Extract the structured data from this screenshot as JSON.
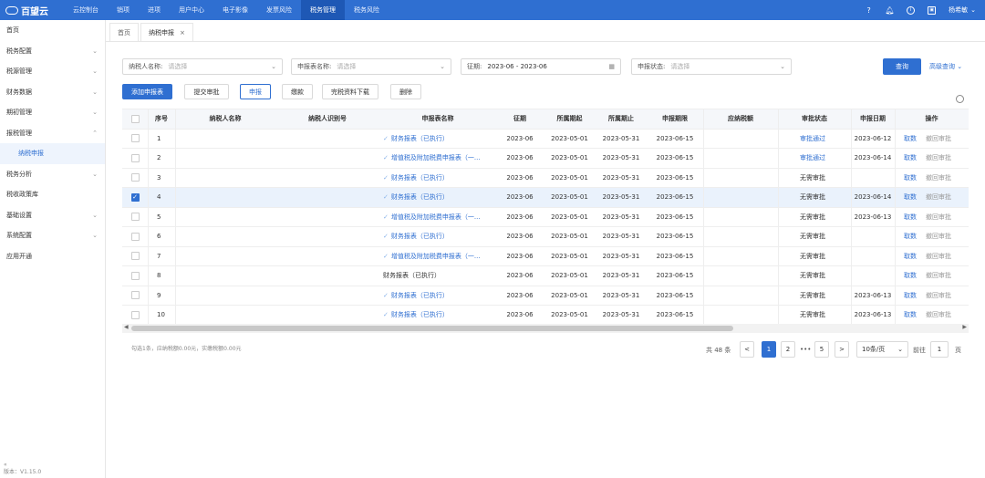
{
  "app": {
    "brand": "百望云"
  },
  "nav": {
    "items": [
      "云控制台",
      "销项",
      "进项",
      "用户中心",
      "电子影像",
      "发票风险",
      "税务管理",
      "税务风险"
    ],
    "active_index": 6
  },
  "topright": {
    "username": "杨希敏"
  },
  "sidebar": {
    "items": [
      {
        "label": "首页",
        "chevron": ""
      },
      {
        "label": "税务配置",
        "chevron": "⌄"
      },
      {
        "label": "税源管理",
        "chevron": "⌄"
      },
      {
        "label": "财务数据",
        "chevron": "⌄"
      },
      {
        "label": "期初管理",
        "chevron": "⌄"
      },
      {
        "label": "报税管理",
        "chevron": "⌃"
      },
      {
        "label": "纳税申报",
        "chevron": "",
        "sub": true
      },
      {
        "label": "税务分析",
        "chevron": "⌄"
      },
      {
        "label": "税收政策库",
        "chevron": ""
      },
      {
        "label": "基础设置",
        "chevron": "⌄"
      },
      {
        "label": "系统配置",
        "chevron": "⌄"
      },
      {
        "label": "应用开通",
        "chevron": ""
      }
    ],
    "collapse": "«",
    "version": "版本：V1.15.0"
  },
  "tabs": [
    {
      "label": "首页",
      "closable": false
    },
    {
      "label": "纳税申报",
      "closable": true
    }
  ],
  "filters": {
    "taxpayer": {
      "label": "纳税人名称:",
      "placeholder": "请选择"
    },
    "form": {
      "label": "申报表名称:",
      "placeholder": "请选择"
    },
    "period": {
      "label": "征期:",
      "value": "2023-06 - 2023-06"
    },
    "status": {
      "label": "申报状态:",
      "placeholder": "请选择"
    },
    "query_label": "查询",
    "advanced_label": "高级查询 ⌄"
  },
  "actions": [
    "添加申报表",
    "提交审批",
    "申报",
    "缴款",
    "完税资料下载",
    "删除"
  ],
  "table": {
    "headers": {
      "index": "序号",
      "taxpayer_name": "纳税人名称",
      "taxpayer_id": "纳税人识别号",
      "form": "申报表名称",
      "period": "征期",
      "start": "所属期起",
      "end": "所属期止",
      "deadline": "申报期限",
      "tax_due": "应纳税额",
      "approval": "审批状态",
      "date": "申报日期",
      "ops": "操作"
    },
    "rows": [
      {
        "index": "1",
        "form": "财务报表（已执行）",
        "form_link": true,
        "period": "2023-06",
        "start": "2023-05-01",
        "end": "2023-05-31",
        "deadline": "2023-06-15",
        "approval": "审批通过",
        "approval_link": true,
        "date": "2023-06-12",
        "op1": "取数",
        "op2": "撤回审批",
        "checked": false
      },
      {
        "index": "2",
        "form": "增值税及附加税费申报表（一...",
        "form_link": true,
        "period": "2023-06",
        "start": "2023-05-01",
        "end": "2023-05-31",
        "deadline": "2023-06-15",
        "approval": "审批通过",
        "approval_link": true,
        "date": "2023-06-14",
        "op1": "取数",
        "op2": "撤回审批",
        "checked": false
      },
      {
        "index": "3",
        "form": "财务报表（已执行）",
        "form_link": true,
        "period": "2023-06",
        "start": "2023-05-01",
        "end": "2023-05-31",
        "deadline": "2023-06-15",
        "approval": "无需审批",
        "approval_link": false,
        "date": "",
        "op1": "取数",
        "op2": "撤回审批",
        "checked": false
      },
      {
        "index": "4",
        "form": "财务报表（已执行）",
        "form_link": true,
        "period": "2023-06",
        "start": "2023-05-01",
        "end": "2023-05-31",
        "deadline": "2023-06-15",
        "approval": "无需审批",
        "approval_link": false,
        "date": "2023-06-14",
        "op1": "取数",
        "op2": "撤回审批",
        "checked": true
      },
      {
        "index": "5",
        "form": "增值税及附加税费申报表（一...",
        "form_link": true,
        "period": "2023-06",
        "start": "2023-05-01",
        "end": "2023-05-31",
        "deadline": "2023-06-15",
        "approval": "无需审批",
        "approval_link": false,
        "date": "2023-06-13",
        "op1": "取数",
        "op2": "撤回审批",
        "checked": false
      },
      {
        "index": "6",
        "form": "财务报表（已执行）",
        "form_link": true,
        "period": "2023-06",
        "start": "2023-05-01",
        "end": "2023-05-31",
        "deadline": "2023-06-15",
        "approval": "无需审批",
        "approval_link": false,
        "date": "",
        "op1": "取数",
        "op2": "撤回审批",
        "checked": false
      },
      {
        "index": "7",
        "form": "增值税及附加税费申报表（一...",
        "form_link": true,
        "period": "2023-06",
        "start": "2023-05-01",
        "end": "2023-05-31",
        "deadline": "2023-06-15",
        "approval": "无需审批",
        "approval_link": false,
        "date": "",
        "op1": "取数",
        "op2": "撤回审批",
        "checked": false
      },
      {
        "index": "8",
        "form": "财务报表（已执行）",
        "form_link": false,
        "period": "2023-06",
        "start": "2023-05-01",
        "end": "2023-05-31",
        "deadline": "2023-06-15",
        "approval": "无需审批",
        "approval_link": false,
        "date": "",
        "op1": "取数",
        "op2": "撤回审批",
        "checked": false
      },
      {
        "index": "9",
        "form": "财务报表（已执行）",
        "form_link": true,
        "period": "2023-06",
        "start": "2023-05-01",
        "end": "2023-05-31",
        "deadline": "2023-06-15",
        "approval": "无需审批",
        "approval_link": false,
        "date": "2023-06-13",
        "op1": "取数",
        "op2": "撤回审批",
        "checked": false
      },
      {
        "index": "10",
        "form": "财务报表（已执行）",
        "form_link": true,
        "period": "2023-06",
        "start": "2023-05-01",
        "end": "2023-05-31",
        "deadline": "2023-06-15",
        "approval": "无需审批",
        "approval_link": false,
        "date": "2023-06-13",
        "op1": "取数",
        "op2": "撤回审批",
        "checked": false
      }
    ]
  },
  "summary": "勾选1条，应纳税额0.00元，实缴税额0.00元",
  "pagination": {
    "total": "共 48 条",
    "prev": "<",
    "next": ">",
    "pages": [
      "1",
      "2",
      "•••",
      "5"
    ],
    "active_page": "1",
    "page_size": "10条/页",
    "goto_label": "前往",
    "goto_value": "1",
    "page_suffix": "页"
  },
  "colors": {
    "primary": "#2f6fd1",
    "nav_bg": "#2f6fd1",
    "nav_active": "#1e58b5"
  }
}
